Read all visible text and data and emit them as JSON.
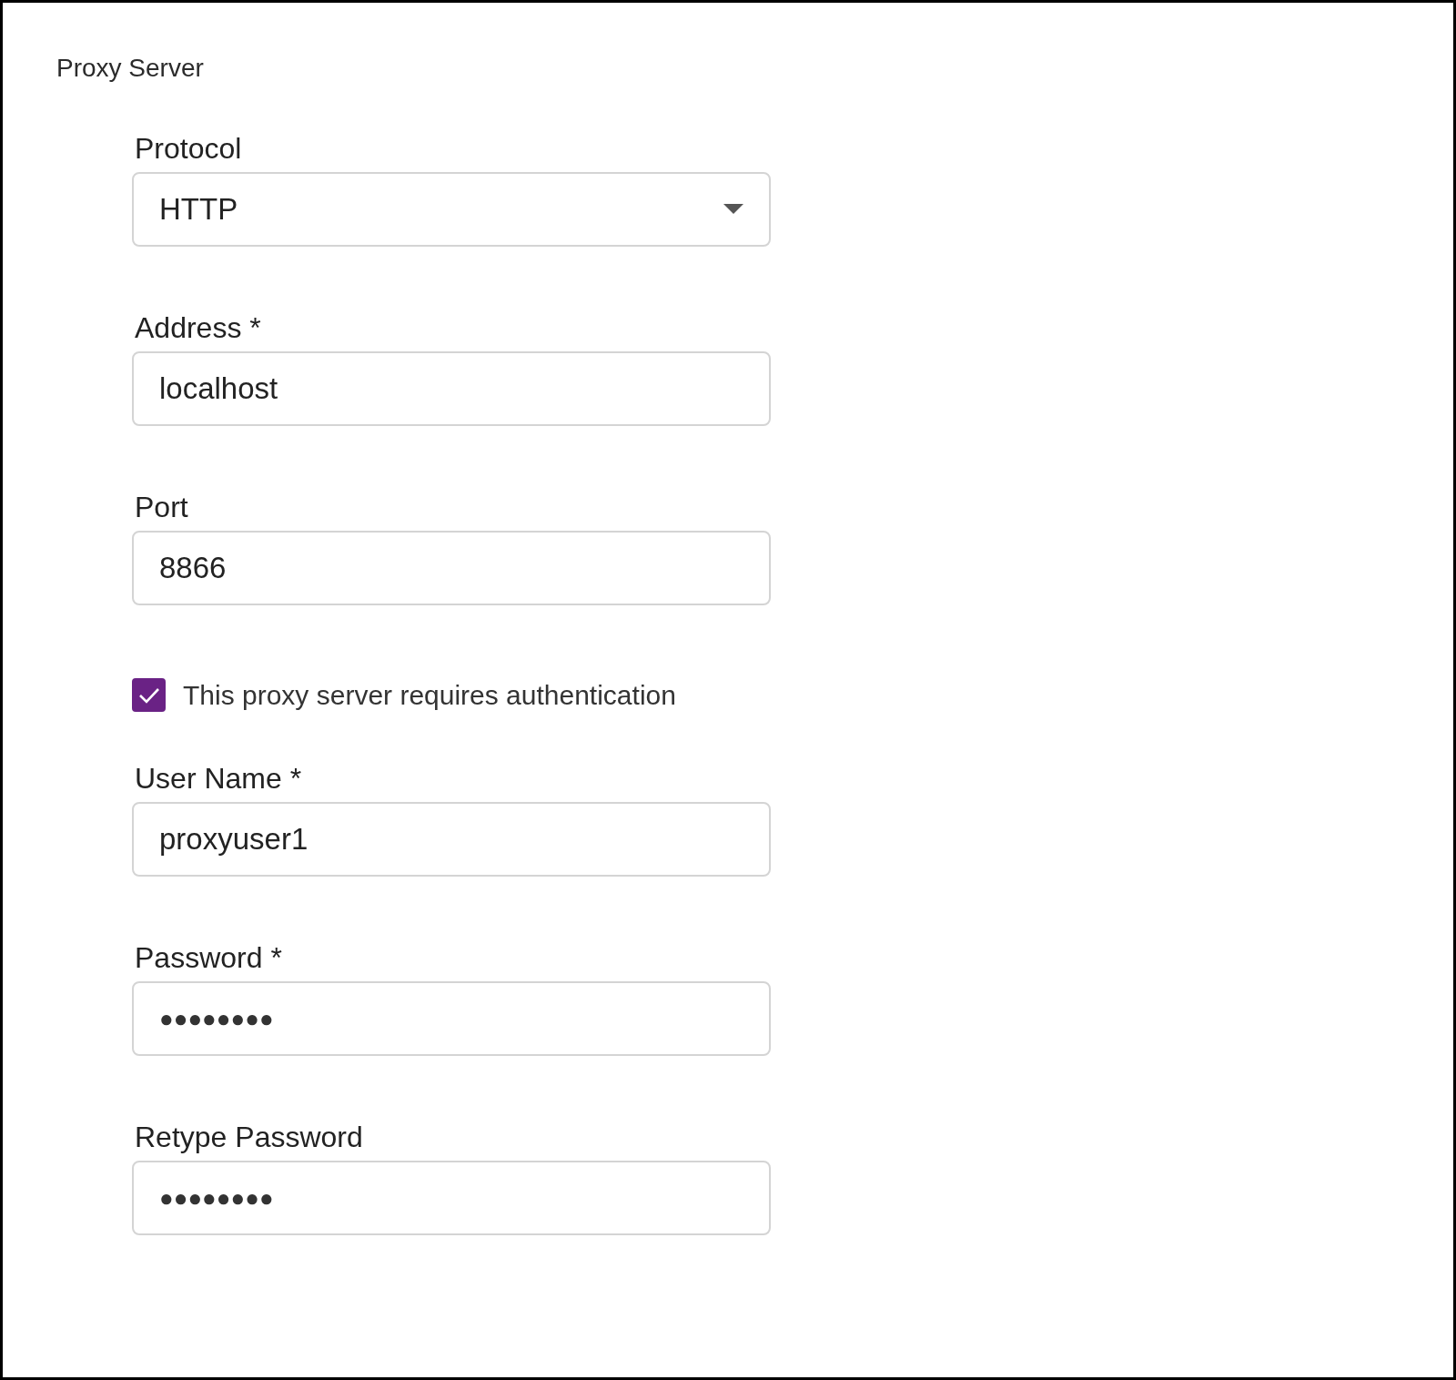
{
  "title": "Proxy Server",
  "fields": [
    {
      "kind": "select",
      "label": "Protocol",
      "value": "HTTP"
    },
    {
      "kind": "text",
      "label": "Address *",
      "value": "localhost"
    },
    {
      "kind": "text",
      "label": "Port",
      "value": "8866"
    },
    {
      "kind": "checkbox",
      "label": "This proxy server requires authentication",
      "checked": true
    },
    {
      "kind": "text",
      "label": "User Name *",
      "value": "proxyuser1"
    },
    {
      "kind": "password",
      "label": "Password *",
      "value": "●●●●●●●●"
    },
    {
      "kind": "password",
      "label": "Retype Password",
      "value": "●●●●●●●●"
    }
  ]
}
